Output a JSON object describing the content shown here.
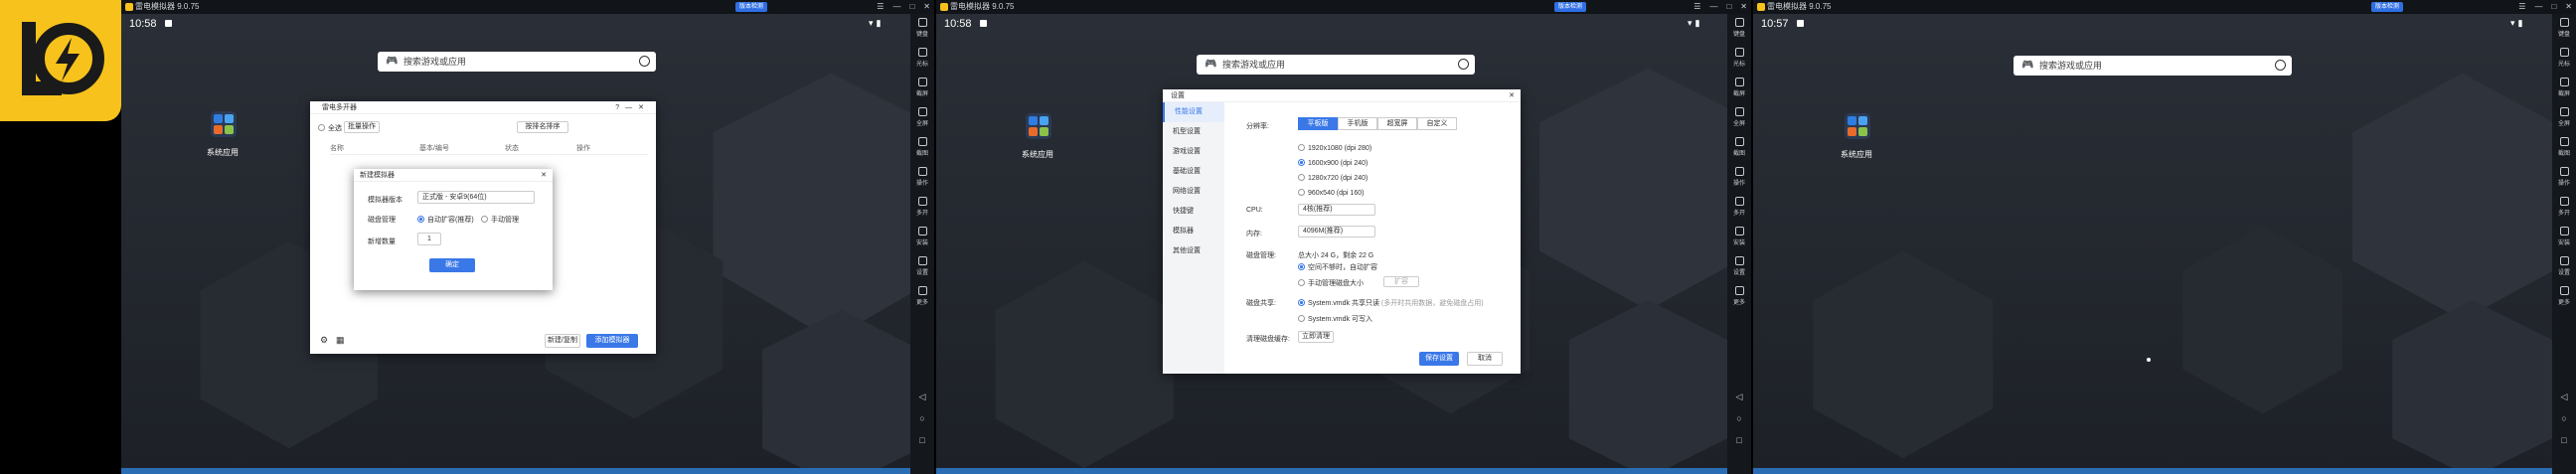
{
  "app": {
    "title": "雷电模拟器 9.0.75",
    "new_version": "版本检测",
    "search_placeholder": "搜索游戏或应用",
    "system_apps_label": "系统应用",
    "colors": {
      "accent": "#3a78e8",
      "logo": "#f7c21b",
      "titlebar": "#111418"
    }
  },
  "sidebar": {
    "items": [
      "键盘",
      "光标",
      "截屏",
      "全屏",
      "截图",
      "操作",
      "多开",
      "安装",
      "设置",
      "更多"
    ]
  },
  "windows": [
    {
      "time": "10:58"
    },
    {
      "time": "10:58"
    },
    {
      "time": "10:57"
    }
  ],
  "multi_manager": {
    "title": "雷电多开器",
    "select_all": "全选",
    "batch_ops": "批量操作",
    "sort": "按排名排序",
    "cols": [
      "名称",
      "基本/编号",
      "状态",
      "操作"
    ],
    "add_simulator": "添加模拟器",
    "new_sim": "新建/复制",
    "new_dialog": {
      "title": "新建模拟器",
      "version_label": "模拟器版本",
      "version_value": "正式版 - 安卓9(64位)",
      "disk_label": "磁盘管理",
      "disk_opt1": "自动扩容(推荐)",
      "disk_opt2": "手动管理",
      "count_label": "新增数量",
      "count_value": "1",
      "confirm": "确定"
    }
  },
  "settings": {
    "title": "设置",
    "tabs": [
      "性能设置",
      "机型设置",
      "游戏设置",
      "基础设置",
      "网络设置",
      "快捷键",
      "模拟器",
      "其他设置"
    ],
    "resolution_label": "分辨率:",
    "res_tabs": [
      "平板版",
      "手机版",
      "超宽屏",
      "自定义"
    ],
    "res_options": [
      "1920x1080 (dpi 280)",
      "1600x900 (dpi 240)",
      "1280x720 (dpi 240)",
      "960x540 (dpi 160)"
    ],
    "cpu_label": "CPU:",
    "cpu_value": "4核(推荐)",
    "mem_label": "内存:",
    "mem_value": "4096M(推荐)",
    "disk_label": "磁盘管理:",
    "disk_info": "总大小 24 G，剩余 22 G",
    "disk_opt1": "空间不够时，自动扩容",
    "disk_opt2": "手动管理磁盘大小",
    "disk_expand": "扩容",
    "disk_share_label": "磁盘共享:",
    "disk_share_opt1": "System.vmdk 共享只读",
    "disk_share_note": "(多开时共用数据，避免磁盘占用)",
    "disk_share_opt2": "System.vmdk 可写入",
    "clear_label": "清理磁盘缓存:",
    "clear_btn": "立即清理",
    "save": "保存设置",
    "cancel": "取消"
  }
}
